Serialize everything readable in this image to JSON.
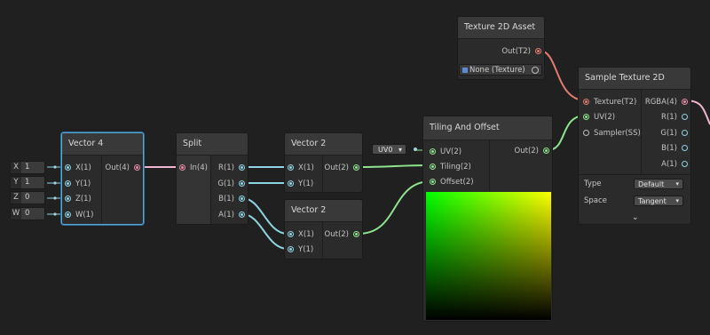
{
  "nodes": {
    "texture2d_asset": {
      "title": "Texture 2D Asset",
      "out": "Out(T2)",
      "field_value": "None (Texture)"
    },
    "vector4": {
      "title": "Vector 4",
      "inputs": [
        "X(1)",
        "Y(1)",
        "Z(1)",
        "W(1)"
      ],
      "out": "Out(4)",
      "input_fields": [
        {
          "label": "X",
          "value": "1"
        },
        {
          "label": "Y",
          "value": "1"
        },
        {
          "label": "Z",
          "value": "0"
        },
        {
          "label": "W",
          "value": "0"
        }
      ]
    },
    "split": {
      "title": "Split",
      "input": "In(4)",
      "outputs": [
        "R(1)",
        "G(1)",
        "B(1)",
        "A(1)"
      ]
    },
    "vector2_a": {
      "title": "Vector 2",
      "inputs": [
        "X(1)",
        "Y(1)"
      ],
      "out": "Out(2)"
    },
    "vector2_b": {
      "title": "Vector 2",
      "inputs": [
        "X(1)",
        "Y(1)"
      ],
      "out": "Out(2)"
    },
    "tiling_offset": {
      "title": "Tiling And Offset",
      "inputs": [
        "UV(2)",
        "Tiling(2)",
        "Offset(2)"
      ],
      "out": "Out(2)",
      "uv_field": "UV0"
    },
    "sample_texture": {
      "title": "Sample Texture 2D",
      "inputs": [
        "Texture(T2)",
        "UV(2)",
        "Sampler(SS)"
      ],
      "outputs": [
        "RGBA(4)",
        "R(1)",
        "G(1)",
        "B(1)",
        "A(1)"
      ],
      "type_label": "Type",
      "type_value": "Default",
      "space_label": "Space",
      "space_value": "Tangent"
    }
  },
  "icons": {
    "dropdown": "▾",
    "expand": "⌄"
  },
  "colors": {
    "background": "#202020",
    "node": "#2b2b2b",
    "selected_outline": "#57a7d6",
    "wire_vector1": "#8fd3e2",
    "wire_vector2": "#8fe38f",
    "wire_vector4": "#f0b5d0",
    "wire_texture": "#e27a6d"
  }
}
